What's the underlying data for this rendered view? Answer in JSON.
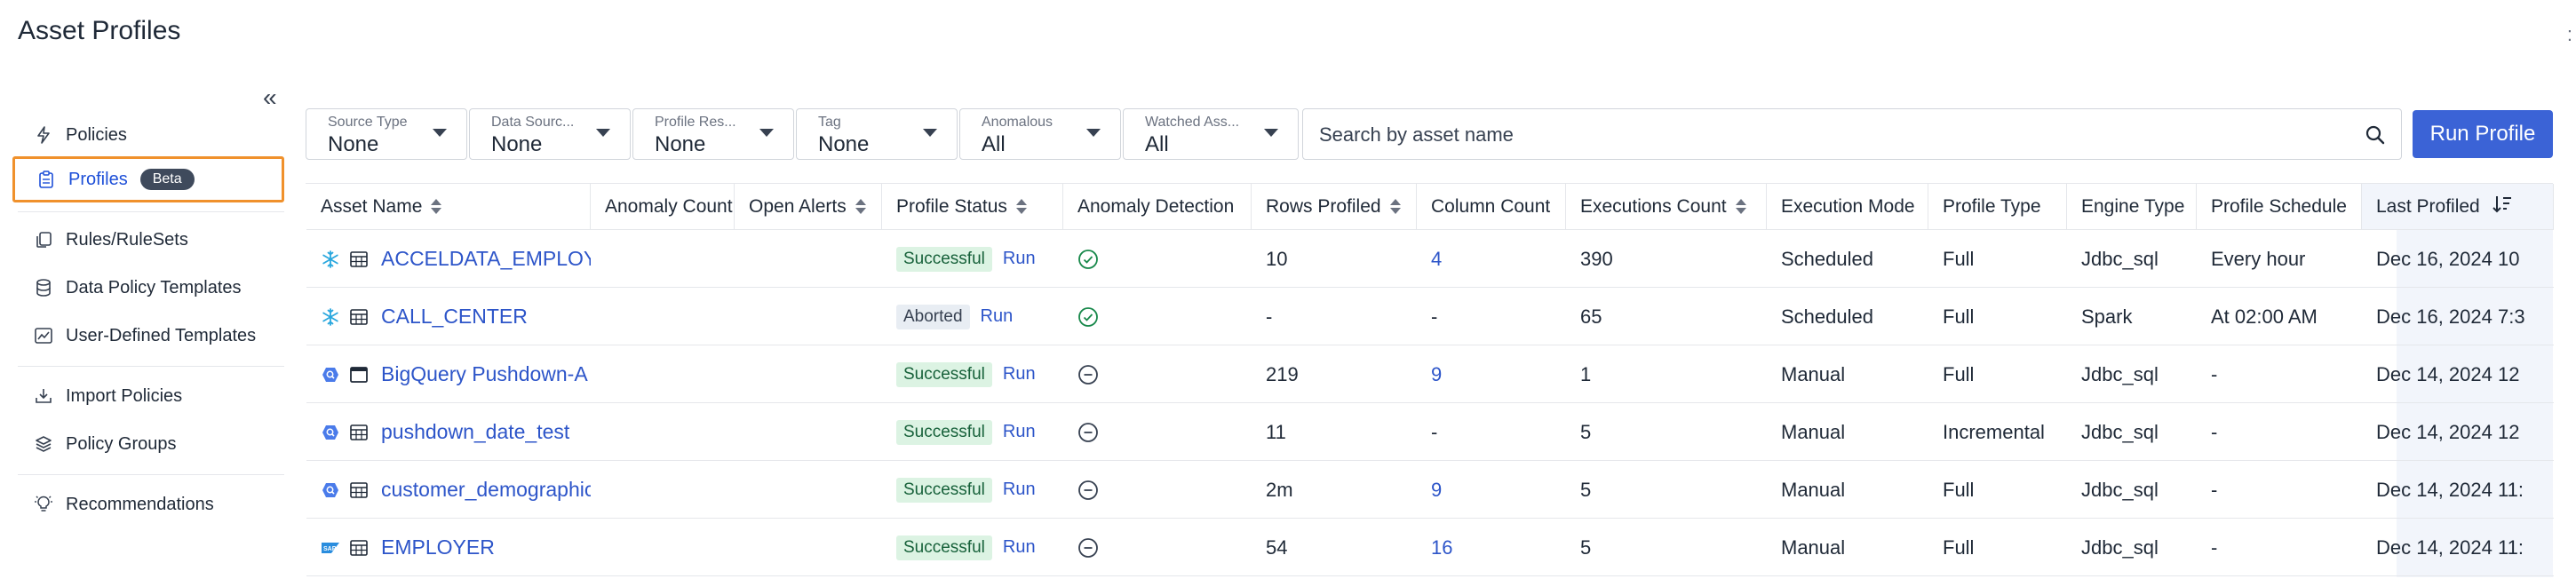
{
  "page": {
    "title": "Asset Profiles"
  },
  "sidebar": {
    "items": [
      {
        "label": "Policies",
        "icon": "bolt-icon"
      },
      {
        "label": "Profiles",
        "icon": "clipboard-icon",
        "badge": "Beta",
        "active": true
      },
      {
        "label": "Rules/RuleSets",
        "icon": "copy-icon"
      },
      {
        "label": "Data Policy Templates",
        "icon": "database-icon"
      },
      {
        "label": "User-Defined Templates",
        "icon": "chart-icon"
      },
      {
        "label": "Import Policies",
        "icon": "import-icon"
      },
      {
        "label": "Policy Groups",
        "icon": "layers-icon"
      },
      {
        "label": "Recommendations",
        "icon": "lightbulb-icon"
      }
    ]
  },
  "filters": [
    {
      "label": "Source Type",
      "value": "None"
    },
    {
      "label": "Data Sourc...",
      "value": "None"
    },
    {
      "label": "Profile Res...",
      "value": "None"
    },
    {
      "label": "Tag",
      "value": "None"
    },
    {
      "label": "Anomalous",
      "value": "All"
    },
    {
      "label": "Watched Ass...",
      "value": "All"
    }
  ],
  "search": {
    "placeholder": "Search by asset name"
  },
  "run_profile_label": "Run Profile",
  "table": {
    "columns": [
      "Asset Name",
      "Anomaly Count",
      "Open Alerts",
      "Profile Status",
      "Anomaly Detection",
      "Rows Profiled",
      "Column Count",
      "Executions Count",
      "Execution Mode",
      "Profile Type",
      "Engine Type",
      "Profile Schedule",
      "Last Profiled"
    ],
    "rows": [
      {
        "source_icon": "snowflake-icon",
        "type_icon": "table-icon",
        "asset_name": "ACCELDATA_EMPLOYEE",
        "anomaly_count": "",
        "open_alerts": "",
        "status": "Successful",
        "run": "Run",
        "detection": "check",
        "rows_profiled": "10",
        "column_count": "4",
        "executions_count": "390",
        "execution_mode": "Scheduled",
        "profile_type": "Full",
        "engine_type": "Jdbc_sql",
        "schedule": "Every hour",
        "last_profiled": "Dec 16, 2024 10"
      },
      {
        "source_icon": "snowflake-icon",
        "type_icon": "table-icon",
        "asset_name": "CALL_CENTER",
        "anomaly_count": "",
        "open_alerts": "",
        "status": "Aborted",
        "run": "Run",
        "detection": "check",
        "rows_profiled": "-",
        "column_count": "-",
        "executions_count": "65",
        "execution_mode": "Scheduled",
        "profile_type": "Full",
        "engine_type": "Spark",
        "schedule": "At 02:00 AM",
        "last_profiled": "Dec 16, 2024 7:3"
      },
      {
        "source_icon": "bigquery-icon",
        "type_icon": "window-icon",
        "asset_name": "BigQuery Pushdown-A",
        "anomaly_count": "",
        "open_alerts": "",
        "status": "Successful",
        "run": "Run",
        "detection": "minus",
        "rows_profiled": "219",
        "column_count": "9",
        "executions_count": "1",
        "execution_mode": "Manual",
        "profile_type": "Full",
        "engine_type": "Jdbc_sql",
        "schedule": "-",
        "last_profiled": "Dec 14, 2024 12"
      },
      {
        "source_icon": "bigquery-icon",
        "type_icon": "table-icon",
        "asset_name": "pushdown_date_test",
        "anomaly_count": "",
        "open_alerts": "",
        "status": "Successful",
        "run": "Run",
        "detection": "minus",
        "rows_profiled": "11",
        "column_count": "-",
        "executions_count": "5",
        "execution_mode": "Manual",
        "profile_type": "Incremental",
        "engine_type": "Jdbc_sql",
        "schedule": "-",
        "last_profiled": "Dec 14, 2024 12"
      },
      {
        "source_icon": "bigquery-icon",
        "type_icon": "table-icon",
        "asset_name": "customer_demographics",
        "anomaly_count": "",
        "open_alerts": "",
        "status": "Successful",
        "run": "Run",
        "detection": "minus",
        "rows_profiled": "2m",
        "column_count": "9",
        "executions_count": "5",
        "execution_mode": "Manual",
        "profile_type": "Full",
        "engine_type": "Jdbc_sql",
        "schedule": "-",
        "last_profiled": "Dec 14, 2024 11:"
      },
      {
        "source_icon": "sap-icon",
        "type_icon": "table-icon",
        "asset_name": "EMPLOYER",
        "anomaly_count": "",
        "open_alerts": "",
        "status": "Successful",
        "run": "Run",
        "detection": "minus",
        "rows_profiled": "54",
        "column_count": "16",
        "executions_count": "5",
        "execution_mode": "Manual",
        "profile_type": "Full",
        "engine_type": "Jdbc_sql",
        "schedule": "-",
        "last_profiled": "Dec 14, 2024 11:"
      }
    ]
  }
}
